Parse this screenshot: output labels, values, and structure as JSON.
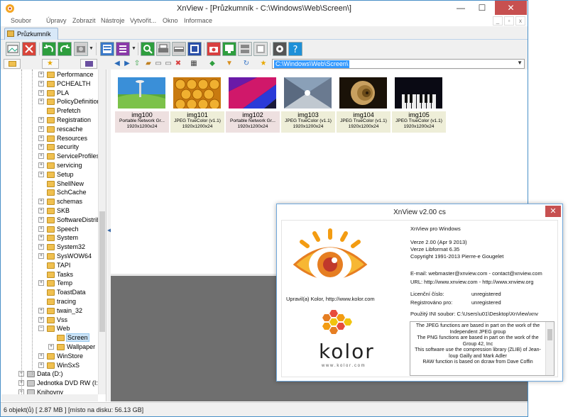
{
  "window": {
    "title": "XnView - [Průzkumník - C:\\Windows\\Web\\Screen\\]",
    "minimize": "—",
    "maximize": "☐",
    "close": "✕"
  },
  "menu": {
    "items": [
      "Soubor",
      "Úpravy",
      "Zobrazit",
      "Nástroje",
      "Vytvořit...",
      "Okno",
      "Informace"
    ],
    "mdi_min": "_",
    "mdi_max": "▫",
    "mdi_close": "x"
  },
  "tab": {
    "label": "Průzkumník"
  },
  "address": {
    "path": "C:\\Windows\\Web\\Screen\\"
  },
  "tree": {
    "items": [
      {
        "label": "Performance",
        "level": 2,
        "expander": "+"
      },
      {
        "label": "PCHEALTH",
        "level": 2,
        "expander": "+"
      },
      {
        "label": "PLA",
        "level": 2,
        "expander": "+"
      },
      {
        "label": "PolicyDefinitions",
        "level": 2,
        "expander": "+"
      },
      {
        "label": "Prefetch",
        "level": 2,
        "expander": ""
      },
      {
        "label": "Registration",
        "level": 2,
        "expander": "+"
      },
      {
        "label": "rescache",
        "level": 2,
        "expander": "+"
      },
      {
        "label": "Resources",
        "level": 2,
        "expander": "+"
      },
      {
        "label": "security",
        "level": 2,
        "expander": "+"
      },
      {
        "label": "ServiceProfiles",
        "level": 2,
        "expander": "+"
      },
      {
        "label": "servicing",
        "level": 2,
        "expander": "+"
      },
      {
        "label": "Setup",
        "level": 2,
        "expander": "+"
      },
      {
        "label": "ShellNew",
        "level": 2,
        "expander": ""
      },
      {
        "label": "SchCache",
        "level": 2,
        "expander": ""
      },
      {
        "label": "schemas",
        "level": 2,
        "expander": "+"
      },
      {
        "label": "SKB",
        "level": 2,
        "expander": "+"
      },
      {
        "label": "SoftwareDistribution",
        "level": 2,
        "expander": "+"
      },
      {
        "label": "Speech",
        "level": 2,
        "expander": "+"
      },
      {
        "label": "System",
        "level": 2,
        "expander": "+"
      },
      {
        "label": "System32",
        "level": 2,
        "expander": "+"
      },
      {
        "label": "SysWOW64",
        "level": 2,
        "expander": "+"
      },
      {
        "label": "TAPI",
        "level": 2,
        "expander": ""
      },
      {
        "label": "Tasks",
        "level": 2,
        "expander": ""
      },
      {
        "label": "Temp",
        "level": 2,
        "expander": "+"
      },
      {
        "label": "ToastData",
        "level": 2,
        "expander": ""
      },
      {
        "label": "tracing",
        "level": 2,
        "expander": ""
      },
      {
        "label": "twain_32",
        "level": 2,
        "expander": "+"
      },
      {
        "label": "Vss",
        "level": 2,
        "expander": "+"
      },
      {
        "label": "Web",
        "level": 2,
        "expander": "−"
      },
      {
        "label": "Screen",
        "level": 3,
        "expander": "",
        "selected": true
      },
      {
        "label": "Wallpaper",
        "level": 3,
        "expander": "+"
      },
      {
        "label": "WinStore",
        "level": 2,
        "expander": "+"
      },
      {
        "label": "WinSxS",
        "level": 2,
        "expander": "+"
      },
      {
        "label": "Data (D:)",
        "level": 1,
        "expander": "+"
      },
      {
        "label": "Jednotka DVD RW (I:)",
        "level": 1,
        "expander": "+"
      },
      {
        "label": "Knihovny",
        "level": 1,
        "expander": "+"
      }
    ]
  },
  "thumbnails": [
    {
      "name": "img100",
      "type": "Portable Network Gr...",
      "dims": "1920x1200x24",
      "color": "#eee0e0"
    },
    {
      "name": "img101",
      "type": "JPEG TrueColor (v1.1)",
      "dims": "1920x1200x24",
      "color": "#eeeed8"
    },
    {
      "name": "img102",
      "type": "Portable Network Gr...",
      "dims": "1920x1200x24",
      "color": "#eee0e0"
    },
    {
      "name": "img103",
      "type": "JPEG TrueColor (v1.1)",
      "dims": "1920x1200x24",
      "color": "#eeeed8"
    },
    {
      "name": "img104",
      "type": "JPEG TrueColor (v1.1)",
      "dims": "1920x1200x24",
      "color": "#eeeed8"
    },
    {
      "name": "img105",
      "type": "JPEG TrueColor (v1.1)",
      "dims": "1920x1200x24",
      "color": "#eeeed8"
    }
  ],
  "status": {
    "text": "6 objekt(ů) [ 2.87 MB ] [místo na disku: 56.13 GB]"
  },
  "about": {
    "title": "XnView v2.00 cs",
    "close": "✕",
    "product": "XnView pro Windows",
    "version": "Verze 2.00 (Apr  9 2013)",
    "libformat": "Verze Libformat 6.35",
    "copyright": "Copyright 1991-2013 Pierre-e Gougelet",
    "email": "E-mail: webmaster@xnview.com - contact@xnview.com",
    "url": "URL: http://www.xnview.com - http://www.xnview.org",
    "license_label": "Licenční číslo:",
    "license_value": "unregistered",
    "registered_label": "Registrováno pro:",
    "registered_value": "unregistered",
    "ini": "Použitý INI soubor: C:\\Users\\u01\\Desktop\\XnView\\xnv",
    "modified_by": "Upravil(a) Kolor, http://www.kolor.com",
    "kolor_name": "Kolor",
    "kolor_url": "w w w . k o l o r . c o m",
    "info_text": "The JPEG functions are based in part on the work of the Independent JPEG group\nThe PNG functions are based in part on the work of the Group 42, Inc\nThis software use the compression library (ZLIB) of Jean-loup Gailly and Mark Adler\nRAW function is based on dcraw from Dave Coffin"
  }
}
